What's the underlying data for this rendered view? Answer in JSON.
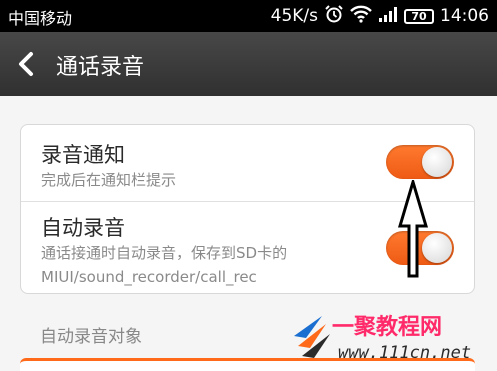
{
  "status_bar": {
    "carrier": "中国移动",
    "speed": "45K/s",
    "battery": "70",
    "time": "14:06"
  },
  "titlebar": {
    "title": "通话录音"
  },
  "settings": [
    {
      "title": "录音通知",
      "subtitle": "完成后在通知栏提示",
      "enabled": true
    },
    {
      "title": "自动录音",
      "subtitle": "通话接通时自动录音，保存到SD卡的MIUI/sound_recorder/call_rec",
      "enabled": true
    }
  ],
  "section_label": "自动录音对象",
  "watermark": {
    "brand": "一聚教程网",
    "url": "www.111cn.net"
  },
  "colors": {
    "accent": "#ff6a1a",
    "titlebar": "#3a3a3a"
  }
}
